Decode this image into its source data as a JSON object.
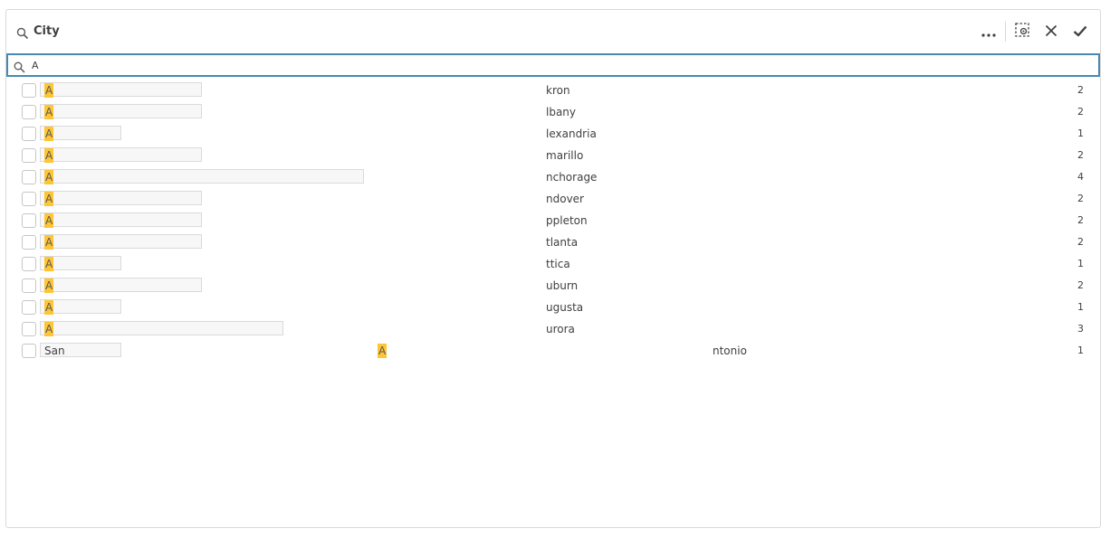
{
  "header": {
    "title": "City"
  },
  "search": {
    "value": "A"
  },
  "colors": {
    "highlight": "#ffc534",
    "search_border": "#4a88b3"
  },
  "icons": {
    "header_search": "search-icon",
    "more": "more-options-icon",
    "selection_tool": "lasso-select-icon",
    "cancel": "close-icon",
    "confirm": "check-icon"
  },
  "rows": [
    {
      "highlight": "A",
      "rest": "kron",
      "count": "2",
      "bar_fraction": 0.5
    },
    {
      "highlight": "A",
      "rest": "lbany",
      "count": "2",
      "bar_fraction": 0.5
    },
    {
      "highlight": "A",
      "rest": "lexandria",
      "count": "1",
      "bar_fraction": 0.25
    },
    {
      "highlight": "A",
      "rest": "marillo",
      "count": "2",
      "bar_fraction": 0.5
    },
    {
      "highlight": "A",
      "rest": "nchorage",
      "count": "4",
      "bar_fraction": 1.0
    },
    {
      "highlight": "A",
      "rest": "ndover",
      "count": "2",
      "bar_fraction": 0.5
    },
    {
      "highlight": "A",
      "rest": "ppleton",
      "count": "2",
      "bar_fraction": 0.5
    },
    {
      "highlight": "A",
      "rest": "tlanta",
      "count": "2",
      "bar_fraction": 0.5
    },
    {
      "highlight": "A",
      "rest": "ttica",
      "count": "1",
      "bar_fraction": 0.25
    },
    {
      "highlight": "A",
      "rest": "uburn",
      "count": "2",
      "bar_fraction": 0.5
    },
    {
      "highlight": "A",
      "rest": "ugusta",
      "count": "1",
      "bar_fraction": 0.25
    },
    {
      "highlight": "A",
      "rest": "urora",
      "count": "3",
      "bar_fraction": 0.75
    },
    {
      "prefix": "San",
      "highlight": "A",
      "rest": "ntonio",
      "count": "1",
      "bar_fraction": 0.25
    }
  ]
}
